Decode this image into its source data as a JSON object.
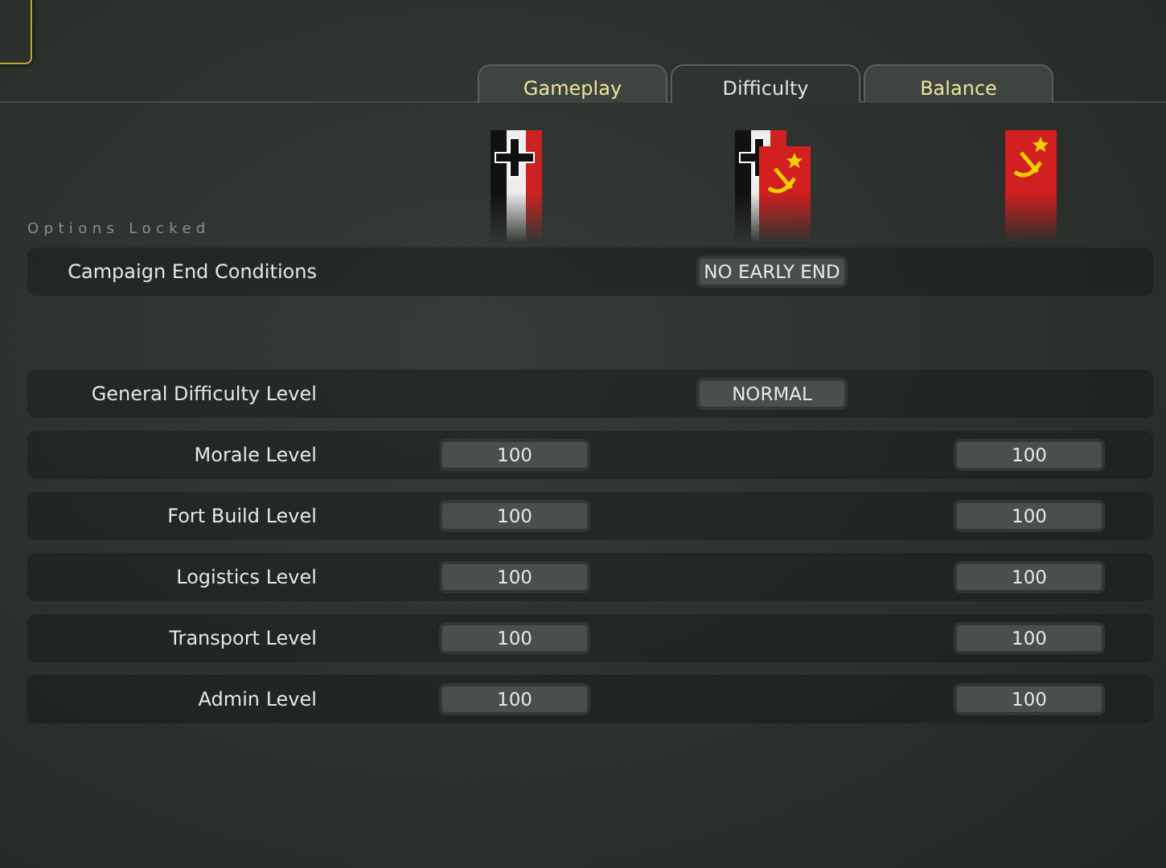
{
  "tabs": [
    {
      "label": "Gameplay",
      "selected": false
    },
    {
      "label": "Difficulty",
      "selected": true
    },
    {
      "label": "Balance",
      "selected": false
    }
  ],
  "flags": [
    {
      "kind": "german"
    },
    {
      "kind": "mixed"
    },
    {
      "kind": "soviet"
    }
  ],
  "status": "Options Locked",
  "groups": [
    [
      {
        "kind": "shared",
        "label": "Campaign End Conditions",
        "value": "NO EARLY END"
      }
    ],
    [
      {
        "kind": "shared",
        "label": "General Difficulty Level",
        "value": "NORMAL"
      },
      {
        "kind": "sides",
        "label": "Morale Level",
        "values": [
          "100",
          "100"
        ]
      },
      {
        "kind": "sides",
        "label": "Fort Build Level",
        "values": [
          "100",
          "100"
        ]
      },
      {
        "kind": "sides",
        "label": "Logistics Level",
        "values": [
          "100",
          "100"
        ]
      },
      {
        "kind": "sides",
        "label": "Transport Level",
        "values": [
          "100",
          "100"
        ]
      },
      {
        "kind": "sides",
        "label": "Admin Level",
        "values": [
          "100",
          "100"
        ]
      }
    ]
  ]
}
